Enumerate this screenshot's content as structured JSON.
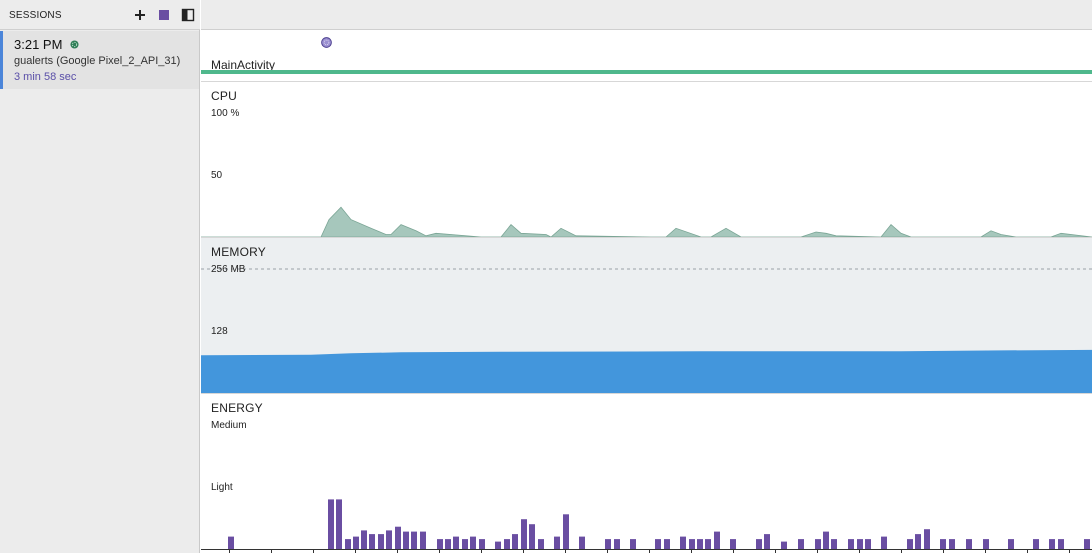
{
  "sessions": {
    "header_title": "SESSIONS",
    "icons": {
      "add": "plus-icon",
      "stop": "stop-square-icon",
      "toggle": "panel-toggle-icon"
    },
    "items": [
      {
        "time": "3:21 PM",
        "device": "gualerts (Google Pixel_2_API_31)",
        "duration": "3 min 58 sec",
        "status": "live-indicator-icon"
      }
    ]
  },
  "timeline": {
    "activity": {
      "label": "MainActivity",
      "marker": "touch-event-icon"
    },
    "lanes": {
      "cpu": {
        "title": "CPU",
        "tick_top": "100 %",
        "tick_mid": "50"
      },
      "memory": {
        "title": "MEMORY",
        "tick_top": "256 MB",
        "tick_mid": "128"
      },
      "energy": {
        "title": "ENERGY",
        "tick_top": "Medium",
        "tick_mid": "Light"
      }
    }
  },
  "colors": {
    "accent": "#4b85d9",
    "activity_bar": "#4fb88c",
    "cpu_fill": "#a6c7bc",
    "memory_fill": "#4396dc",
    "energy_bar": "#6a4ea2",
    "duration_text": "#5a4fa8"
  },
  "chart_data": [
    {
      "type": "area",
      "name": "CPU",
      "ylim": [
        0,
        100
      ],
      "y_unit": "%",
      "x": [
        0,
        40,
        100,
        120,
        128,
        140,
        150,
        170,
        185,
        190,
        200,
        215,
        225,
        235,
        280,
        300,
        310,
        320,
        345,
        350,
        360,
        375,
        450,
        465,
        475,
        500,
        510,
        525,
        540,
        600,
        615,
        625,
        635,
        680,
        690,
        700,
        710,
        730,
        780,
        790,
        800,
        815,
        830,
        850,
        860,
        891
      ],
      "values": [
        0,
        0,
        0,
        0,
        14,
        24,
        14,
        7,
        2,
        2,
        10,
        5,
        1,
        3,
        0,
        0,
        10,
        3,
        2,
        0,
        7,
        1,
        0,
        0,
        7,
        0,
        0,
        7,
        0,
        0,
        4,
        3,
        1,
        0,
        10,
        3,
        0,
        0,
        0,
        5,
        2,
        0,
        0,
        0,
        3,
        0
      ]
    },
    {
      "type": "area",
      "name": "MEMORY",
      "ylim": [
        0,
        256
      ],
      "y_unit": "MB",
      "x": [
        0,
        110,
        150,
        200,
        300,
        500,
        700,
        800,
        891
      ],
      "values": [
        78,
        79,
        82,
        84,
        85,
        86,
        86,
        88,
        89
      ]
    },
    {
      "type": "bar",
      "name": "ENERGY",
      "levels": [
        "Light",
        "Medium"
      ],
      "x": [
        30,
        130,
        138,
        147,
        155,
        163,
        171,
        180,
        188,
        197,
        205,
        213,
        222,
        239,
        247,
        255,
        264,
        272,
        281,
        297,
        306,
        314,
        323,
        331,
        340,
        356,
        365,
        381,
        407,
        416,
        432,
        457,
        466,
        482,
        491,
        499,
        507,
        516,
        532,
        558,
        566,
        583,
        600,
        617,
        625,
        633,
        650,
        659,
        667,
        683,
        709,
        717,
        726,
        742,
        751,
        768,
        785,
        810,
        835,
        851,
        860,
        886
      ],
      "values": [
        0.1,
        0.4,
        0.4,
        0.08,
        0.1,
        0.15,
        0.12,
        0.12,
        0.15,
        0.18,
        0.14,
        0.14,
        0.14,
        0.08,
        0.08,
        0.1,
        0.08,
        0.1,
        0.08,
        0.06,
        0.08,
        0.12,
        0.24,
        0.2,
        0.08,
        0.1,
        0.28,
        0.1,
        0.08,
        0.08,
        0.08,
        0.08,
        0.08,
        0.1,
        0.08,
        0.08,
        0.08,
        0.14,
        0.08,
        0.08,
        0.12,
        0.06,
        0.08,
        0.08,
        0.14,
        0.08,
        0.08,
        0.08,
        0.08,
        0.1,
        0.08,
        0.12,
        0.16,
        0.08,
        0.08,
        0.08,
        0.08,
        0.08,
        0.08,
        0.08,
        0.08,
        0.08
      ]
    }
  ]
}
